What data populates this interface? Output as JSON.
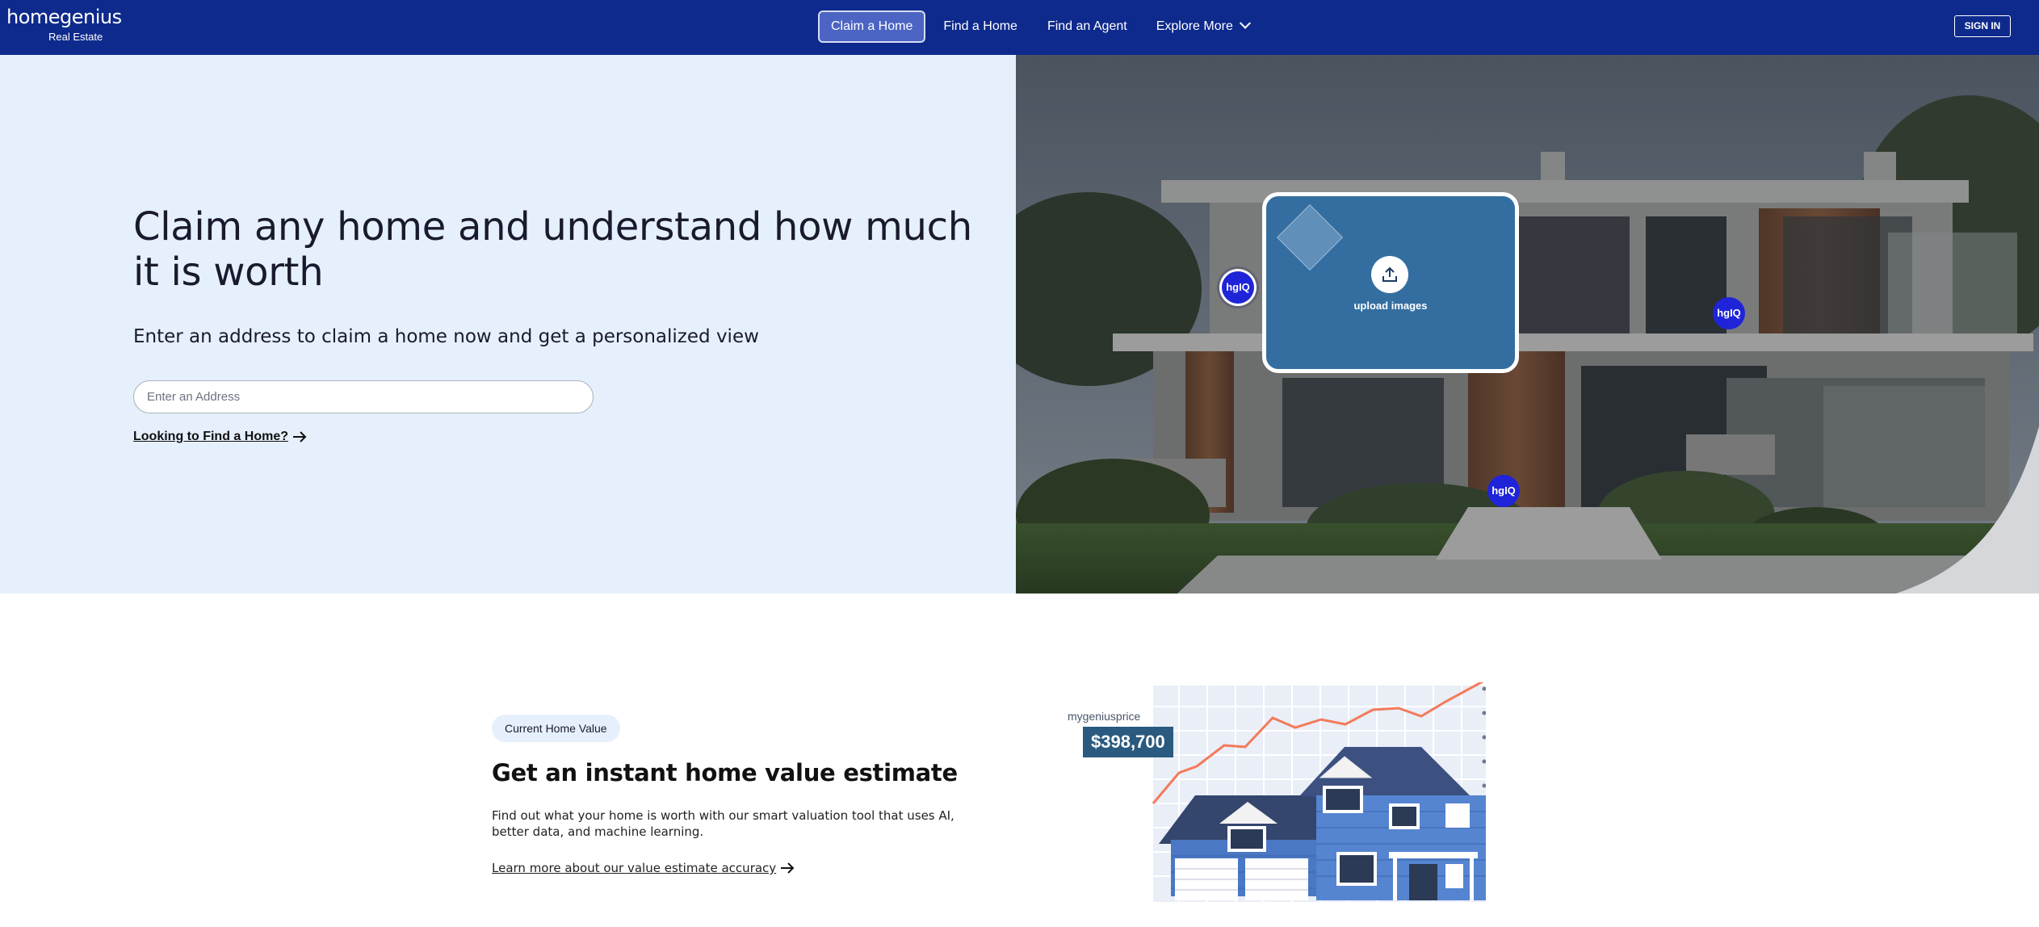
{
  "nav": {
    "logo": "homegenius",
    "logo_sub": "Real Estate",
    "links": [
      "Claim a Home",
      "Find a Home",
      "Find an Agent",
      "Explore More"
    ],
    "signin": "SIGN IN"
  },
  "hero": {
    "title": "Claim any home and understand how much it is worth",
    "subtitle": "Enter an address to claim a home now and get a personalized view",
    "address_placeholder": "Enter an Address",
    "find_link": "Looking to Find a Home?",
    "upload_label": "upload images",
    "hotspot_label": "hgIQ"
  },
  "value": {
    "badge": "Current Home Value",
    "title": "Get an instant home value estimate",
    "description": "Find out what your home is worth with our smart valuation tool that uses AI, better data, and machine learning.",
    "learn_link": "Learn more about our value estimate accuracy",
    "price_label": "mygeniusprice",
    "price": "$398,700"
  },
  "colors": {
    "nav_bg": "#0e2a8c",
    "hero_left_bg": "#e6f0fd",
    "hotspot": "#1f24d8",
    "upload_card": "#346ea1",
    "trend_line": "#f47a5a",
    "price_box": "#2a5a7f"
  },
  "icons": [
    "chevron-down-icon",
    "arrow-right-icon",
    "upload-icon"
  ]
}
